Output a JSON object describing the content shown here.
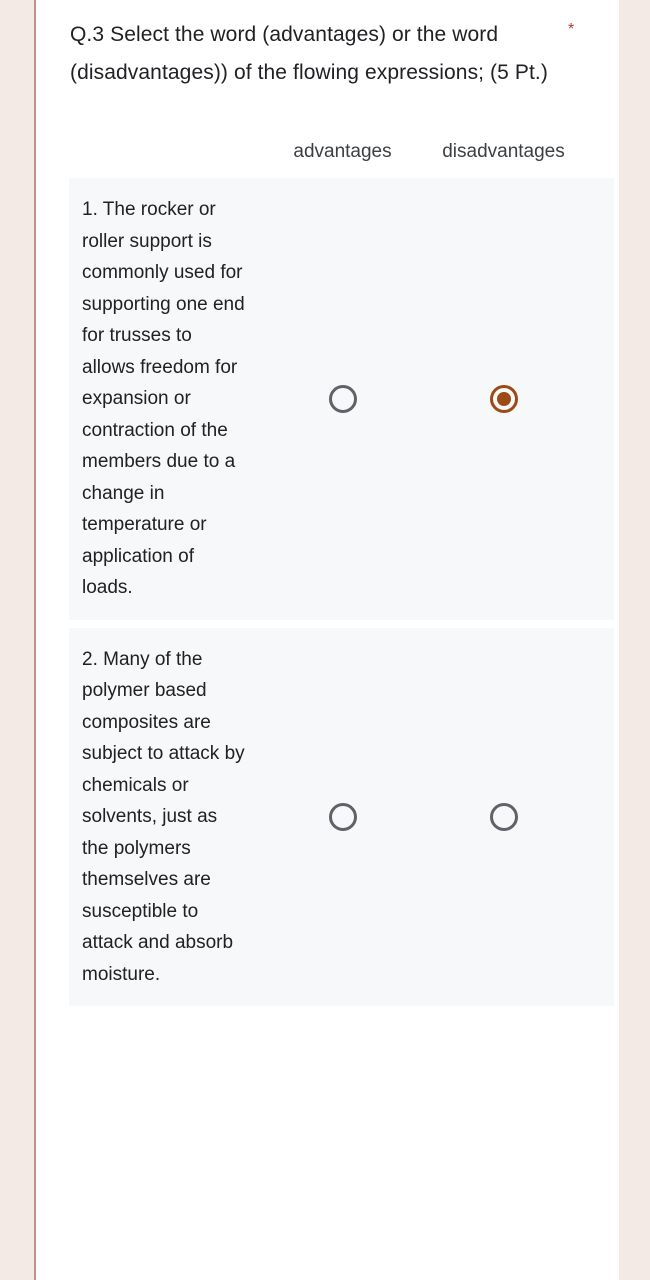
{
  "page": {
    "background_color": "#F3E9E5",
    "card_background_color": "#FFFFFF",
    "rule_color": "#C98C89"
  },
  "question": {
    "title": "Q.3  Select the word (advantages) or the word (disadvantages)) of the flowing expressions; (5 Pt.)",
    "required_marker": "*",
    "required_marker_color": "#B23A2E"
  },
  "grid": {
    "columns": [
      {
        "label": "advantages"
      },
      {
        "label": "disadvantages"
      }
    ],
    "rows": [
      {
        "label": "1. The rocker or roller support is commonly used for supporting one end for trusses to allows freedom for expansion or contraction of the members due to a change in temperature or application of loads.",
        "selected_column": 1,
        "cells": [
          {
            "checked": false
          },
          {
            "checked": true
          }
        ]
      },
      {
        "label": "2. Many of the polymer based composites are subject to attack by chemicals or solvents, just as the polymers themselves are susceptible to attack and absorb moisture.",
        "selected_column": null,
        "cells": [
          {
            "checked": false
          },
          {
            "checked": false
          }
        ]
      }
    ],
    "row_background_color": "#F7F8F9",
    "radio_unchecked_color": "#5F6368",
    "radio_checked_color": "#9C4A16"
  }
}
